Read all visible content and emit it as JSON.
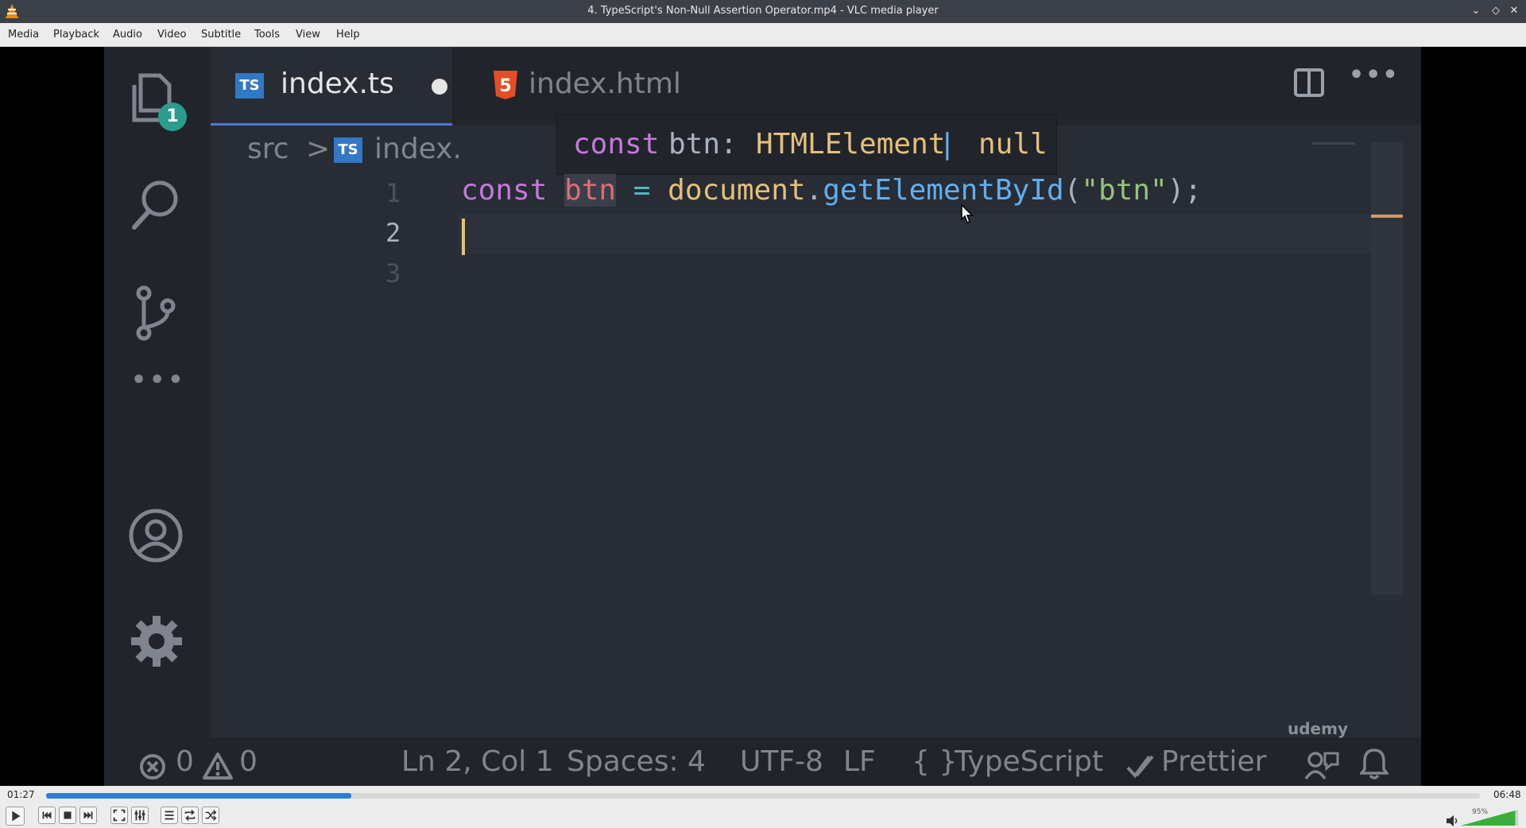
{
  "window": {
    "title": "4. TypeScript's Non-Null Assertion Operator.mp4 - VLC media player"
  },
  "menu": [
    "Media",
    "Playback",
    "Audio",
    "Video",
    "Subtitle",
    "Tools",
    "View",
    "Help"
  ],
  "video": {
    "tabs": [
      {
        "badge": "TS",
        "label": "index.ts",
        "active": true,
        "unsaved": true
      },
      {
        "badge": "5",
        "label": "index.html",
        "active": false
      }
    ],
    "activity_badge": "1",
    "breadcrumb": {
      "folder": "src",
      "sep": ">",
      "badge": "TS",
      "file": "index."
    },
    "hover": {
      "kw": "const",
      "name": "btn:",
      "type": "HTMLElement",
      "pipe": "|",
      "nul": "null"
    },
    "lines": [
      "1",
      "2",
      "3"
    ],
    "code": {
      "kw": "const",
      "ident": "btn",
      "op": "=",
      "obj": "document",
      "dot": ".",
      "fn": "getElementById",
      "lp": "(",
      "str": "\"btn\"",
      "rp": ")",
      "semi": ";"
    },
    "status": {
      "errors": "0",
      "warnings": "0",
      "position": "Ln 2, Col 1",
      "spaces": "Spaces: 4",
      "encoding": "UTF-8",
      "eol": "LF",
      "lang_braces": "{ }",
      "language": "TypeScript",
      "formatter": "Prettier"
    },
    "watermark": "udemy"
  },
  "player": {
    "elapsed": "01:27",
    "total": "06:48",
    "progress": 0.213,
    "volume_text": "95%",
    "volume_level": 0.95
  },
  "colors": {
    "keyword": "#c678dd",
    "variable": "#e06c75",
    "function": "#61afef",
    "string": "#98c379",
    "type": "#e5c07b",
    "accent": "#2f7fd0"
  }
}
